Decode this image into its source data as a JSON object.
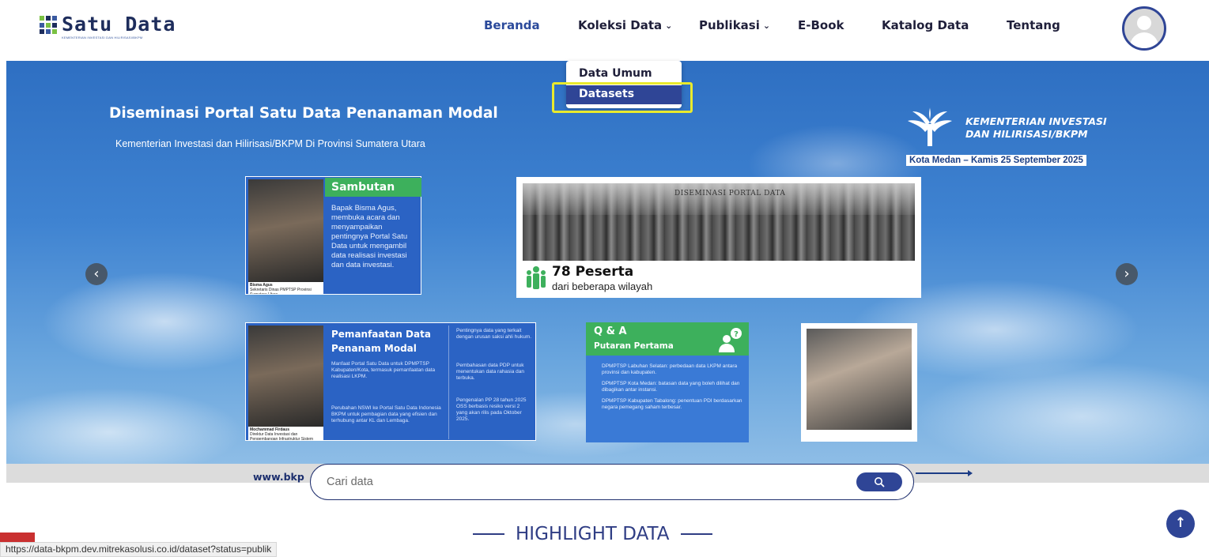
{
  "brand": {
    "name": "Satu Data",
    "subtitle": "KEMENTERIAN INVESTASI DAN HILIRISASI/BKPM",
    "grid_colors": [
      "#1e2d5c",
      "#3a5aa0",
      "#7ac143"
    ]
  },
  "nav": {
    "items": [
      {
        "label": "Beranda",
        "active": true
      },
      {
        "label": "Koleksi Data",
        "has_dropdown": true
      },
      {
        "label": "Publikasi",
        "has_dropdown": true
      },
      {
        "label": "E-Book"
      },
      {
        "label": "Katalog Data"
      },
      {
        "label": "Tentang"
      }
    ],
    "chevron": "⌄"
  },
  "dropdown": {
    "items": [
      "Data Umum",
      "Datasets"
    ],
    "hovered": "Datasets"
  },
  "hero": {
    "title": "Diseminasi Portal Satu Data Penanaman Modal",
    "subtitle": "Kementerian Investasi dan Hilirisasi/BKPM Di Provinsi Sumatera Utara",
    "ministry": {
      "line1": "KEMENTERIAN INVESTASI",
      "line2": "DAN HILIRISASI/BKPM"
    },
    "event_date": "Kota Medan – Kamis 25 September 2025",
    "prev_icon": "‹",
    "next_icon": "›",
    "card_sambutan": {
      "tag": "Sambutan",
      "desc": "Bapak Bisma Agus, membuka acara dan menyampaikan pentingnya Portal Satu Data untuk mengambil data realisasi investasi dan data investasi.",
      "photo_caption_name": "Bisma Agus",
      "photo_caption_role": "Sekretaris Dinas PMPTSP Provinsi Sumatera Utara"
    },
    "card_peserta": {
      "banner_text": "DISEMINASI PORTAL DATA",
      "count": "78 Peserta",
      "sub": "dari beberapa wilayah"
    },
    "card_pemanfaatan": {
      "title": "Pemanfaatan Data Penanam Modal",
      "desc1": "Manfaat Portal Satu Data untuk DPMPTSP Kabupaten/Kota, termasuk pemanfaatan data realisasi LKPM.",
      "desc2": "Perubahan NSWI ke Portal Satu Data Indonesia BKPM untuk pembagian data yang efisien dan terhubung antar KL dan Lembaga.",
      "col_items": [
        "Pentingnya data yang terkait dengan urusan saksi ahli hukum.",
        "Pembahasan data PDP untuk menentukan data rahasia dan terbuka.",
        "Pengenalan PP 28 tahun 2025 OSS berbasis resiko versi 2 yang akan rilis pada Oktober 2025."
      ],
      "photo_caption_name": "Mochammad Firdaus",
      "photo_caption_role": "Direktur Data Investasi dan Pengembangan Infrastruktur Sistem"
    },
    "card_qa": {
      "title": "Q & A",
      "subtitle": "Putaran Pertama",
      "items": [
        "DPMPTSP Labuhan Selatan: perbedaan data LKPM antara provinsi dan kabupaten.",
        "DPMPTSP Kota Medan: batasan data yang boleh dilihat dan dibagikan antar instansi.",
        "DPMPTSP Kabupaten Tabalong: penentuan PDI berdasarkan negara pemegang saham terbesar."
      ]
    },
    "bottom_url": "www.bkp"
  },
  "search": {
    "placeholder": "Cari data",
    "icon": "search-icon"
  },
  "section": {
    "highlight_title": "HIGHLIGHT DATA"
  },
  "back_to_top": {
    "icon": "↑"
  },
  "status_bar": {
    "url": "https://data-bkpm.dev.mitrekasolusi.co.id/dataset?status=publik"
  }
}
